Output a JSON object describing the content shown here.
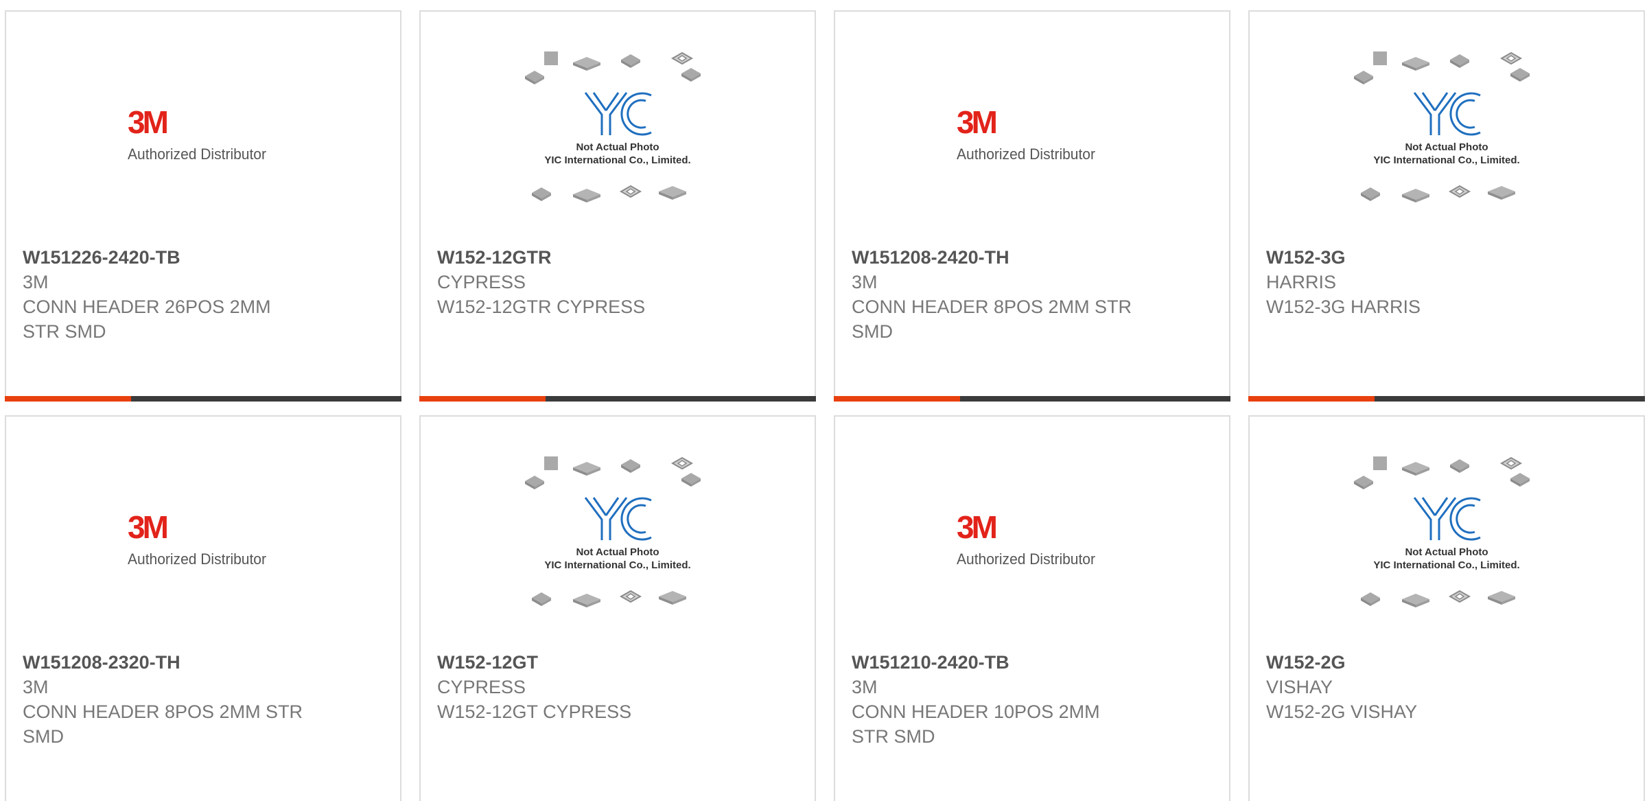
{
  "placeholders": {
    "brand_3m": {
      "logo": "3M",
      "tagline": "Authorized Distributor",
      "color": "#e2231a"
    },
    "yic": {
      "logo": "YIC",
      "line1": "Not Actual Photo",
      "line2": "YIC International Co., Limited.",
      "color": "#1f6fbf"
    }
  },
  "products": [
    {
      "part": "W151226-2420-TB",
      "maker": "3M",
      "desc": "CONN HEADER 26POS 2MM STR SMD",
      "image": "brand-3m"
    },
    {
      "part": "W152-12GTR",
      "maker": "CYPRESS",
      "desc": "W152-12GTR CYPRESS",
      "image": "yic"
    },
    {
      "part": "W151208-2420-TH",
      "maker": "3M",
      "desc": "CONN HEADER 8POS 2MM STR SMD",
      "image": "brand-3m"
    },
    {
      "part": "W152-3G",
      "maker": "HARRIS",
      "desc": "W152-3G HARRIS",
      "image": "yic"
    },
    {
      "part": "W151208-2320-TH",
      "maker": "3M",
      "desc": "CONN HEADER 8POS 2MM STR SMD",
      "image": "brand-3m"
    },
    {
      "part": "W152-12GT",
      "maker": "CYPRESS",
      "desc": "W152-12GT CYPRESS",
      "image": "yic"
    },
    {
      "part": "W151210-2420-TB",
      "maker": "3M",
      "desc": "CONN HEADER 10POS 2MM STR SMD",
      "image": "brand-3m"
    },
    {
      "part": "W152-2G",
      "maker": "VISHAY",
      "desc": "W152-2G VISHAY",
      "image": "yic"
    }
  ],
  "colors": {
    "accent": "#e8400e",
    "bar": "#3b3b3b",
    "border": "#dcdcdc"
  }
}
